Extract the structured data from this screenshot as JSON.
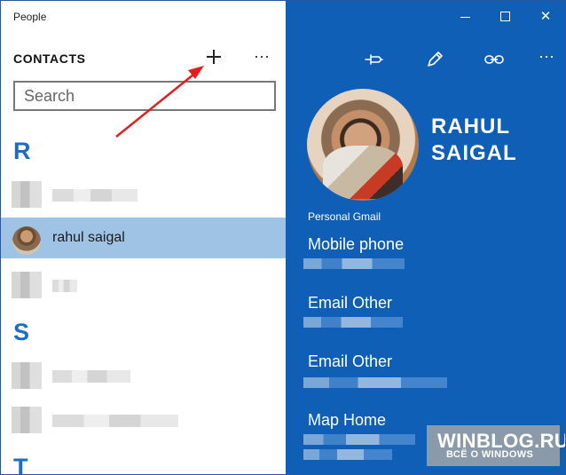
{
  "window": {
    "title": "People"
  },
  "contacts": {
    "title": "CONTACTS",
    "add_label": "Add contact",
    "more_label": "More options",
    "search_placeholder": "Search",
    "sections": [
      "R",
      "S",
      "T"
    ],
    "selected_contact": "rahul saigal"
  },
  "details": {
    "name_line1": "RAHUL",
    "name_line2": "SAIGAL",
    "account_label": "Personal Gmail",
    "fields": [
      "Mobile phone",
      "Email Other",
      "Email Other",
      "Map Home"
    ]
  },
  "watermark": {
    "main": "WINBLOG.RU",
    "sub": "ВСЁ О WINDOWS"
  },
  "colors": {
    "accent": "#0f5fb7",
    "selection": "#9ec3e4",
    "section_letter": "#1a6fc4",
    "annotation_arrow": "#e11f1f"
  }
}
